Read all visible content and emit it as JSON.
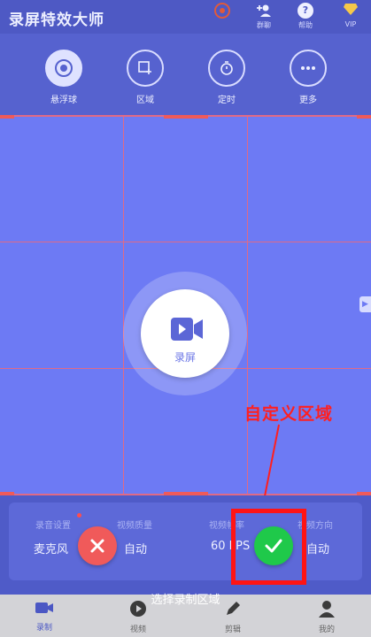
{
  "header": {
    "title": "录屏特效大师",
    "icons": [
      {
        "name": "record-target-icon",
        "caption": ""
      },
      {
        "name": "group-add-icon",
        "caption": "群聊"
      },
      {
        "name": "help-icon",
        "caption": "帮助"
      },
      {
        "name": "vip-diamond-icon",
        "caption": "VIP"
      }
    ]
  },
  "tools": [
    {
      "label": "悬浮球",
      "icon": "floating-ball-icon"
    },
    {
      "label": "区域",
      "icon": "region-select-icon"
    },
    {
      "label": "定时",
      "icon": "timer-icon"
    },
    {
      "label": "更多",
      "icon": "more-dots-icon"
    }
  ],
  "record_button": {
    "label": "录屏"
  },
  "annotation": {
    "text": "自定义区域"
  },
  "settings": {
    "columns": [
      {
        "title": "录音设置",
        "value": "麦克风"
      },
      {
        "title": "视频质量",
        "value": "自动"
      },
      {
        "title": "视频帧率",
        "value": "60 FPS"
      },
      {
        "title": "视频方向",
        "value": "自动"
      }
    ]
  },
  "hint": "选择录制区域",
  "bottom_nav": [
    {
      "label": "录制",
      "icon": "camera-icon",
      "active": true
    },
    {
      "label": "视频",
      "icon": "play-icon",
      "active": false
    },
    {
      "label": "剪辑",
      "icon": "pen-icon",
      "active": false
    },
    {
      "label": "我的",
      "icon": "person-icon",
      "active": false
    }
  ],
  "colors": {
    "primary": "#5b66d6",
    "selection": "#6d7af4",
    "grid_line": "#e06a86",
    "cancel": "#f05a5a",
    "confirm": "#1fc94a",
    "annotation": "#ff1f1f"
  }
}
